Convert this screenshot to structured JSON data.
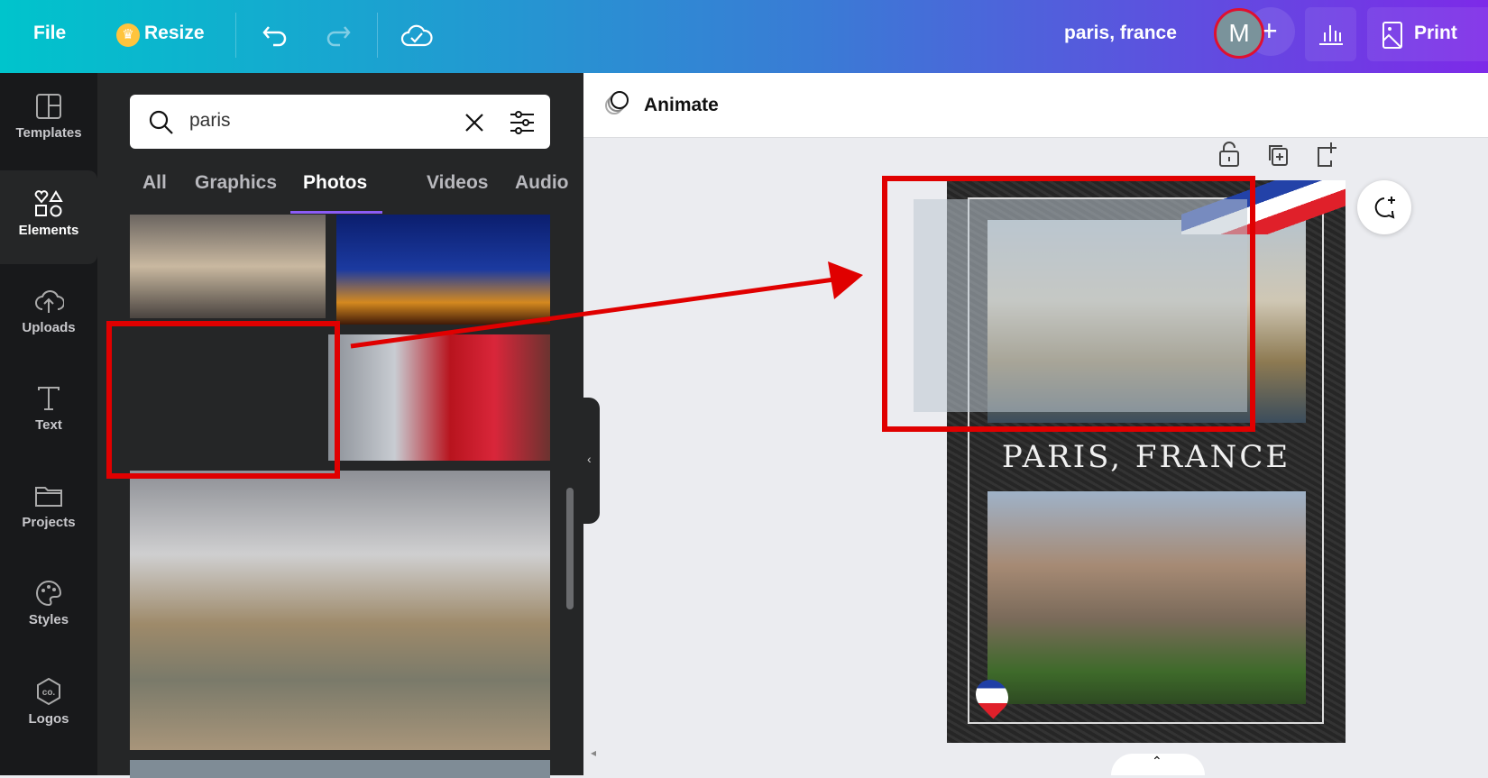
{
  "topbar": {
    "file": "File",
    "resize": "Resize",
    "title": "paris, france",
    "avatar_initial": "M",
    "print": "Print",
    "icons": [
      "undo-icon",
      "redo-icon",
      "cloud-saved-icon",
      "plus-icon",
      "analytics-icon",
      "image-icon"
    ]
  },
  "rail": [
    {
      "label": "Templates",
      "icon": "templates-icon"
    },
    {
      "label": "Elements",
      "icon": "elements-icon",
      "selected": true
    },
    {
      "label": "Uploads",
      "icon": "upload-icon"
    },
    {
      "label": "Text",
      "icon": "text-icon"
    },
    {
      "label": "Projects",
      "icon": "folder-icon"
    },
    {
      "label": "Styles",
      "icon": "palette-icon"
    },
    {
      "label": "Logos",
      "icon": "logo-icon"
    }
  ],
  "search": {
    "value": "paris"
  },
  "tabs": [
    {
      "label": "All"
    },
    {
      "label": "Graphics"
    },
    {
      "label": "Photos",
      "selected": true
    },
    {
      "label": "Videos"
    },
    {
      "label": "Audio"
    }
  ],
  "canvas": {
    "animate": "Animate",
    "page_title": "PARIS, FRANCE"
  },
  "colors": {
    "annotation": "#e00000",
    "accent": "#8b5cf6"
  }
}
